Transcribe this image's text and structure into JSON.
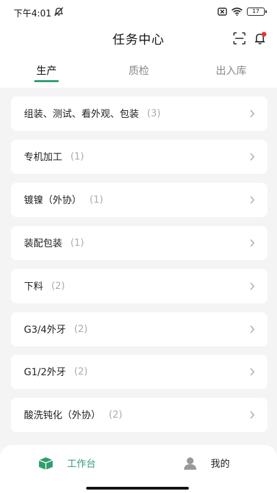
{
  "status_bar": {
    "time": "下午4:01",
    "battery": "17"
  },
  "header": {
    "title": "任务中心"
  },
  "tabs": [
    {
      "label": "生产",
      "active": true
    },
    {
      "label": "质检",
      "active": false
    },
    {
      "label": "出入库",
      "active": false
    }
  ],
  "tasks": [
    {
      "label": "组装、测试、看外观、包装",
      "count": "(3)"
    },
    {
      "label": "专机加工",
      "count": "(1)"
    },
    {
      "label": "镀镍（外协）",
      "count": "(1)"
    },
    {
      "label": "装配包装",
      "count": "(1)"
    },
    {
      "label": "下料",
      "count": "(2)"
    },
    {
      "label": "G3/4外牙",
      "count": "(2)"
    },
    {
      "label": "G1/2外牙",
      "count": "(2)"
    },
    {
      "label": "酸洗钝化（外协）",
      "count": "(2)"
    }
  ],
  "bottom_nav": [
    {
      "label": "工作台",
      "icon": "box-icon",
      "active": true
    },
    {
      "label": "我的",
      "icon": "user-icon",
      "active": false
    }
  ],
  "colors": {
    "accent": "#2e9e6e",
    "background": "#f4f4f4",
    "card": "#ffffff"
  }
}
